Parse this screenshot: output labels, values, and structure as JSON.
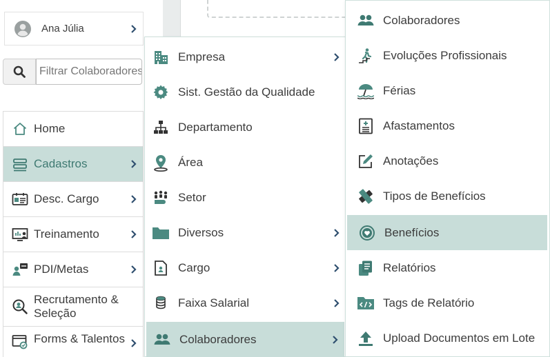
{
  "user": {
    "name": "Ana Júlia"
  },
  "search": {
    "placeholder": "Filtrar Colaboradores"
  },
  "sidebar": {
    "items": [
      {
        "label": "Home",
        "icon": "home-icon"
      },
      {
        "label": "Cadastros",
        "icon": "list-icon",
        "active": true
      },
      {
        "label": "Desc. Cargo",
        "icon": "job-description-icon"
      },
      {
        "label": "Treinamento",
        "icon": "training-icon"
      },
      {
        "label": "PDI/Metas",
        "icon": "goals-icon"
      },
      {
        "label": "Recrutamento & Seleção",
        "icon": "recruitment-icon"
      },
      {
        "label": "Forms & Talentos",
        "icon": "forms-icon"
      }
    ]
  },
  "menu_cadastros": {
    "items": [
      {
        "label": "Empresa",
        "icon": "building-icon"
      },
      {
        "label": "Sist. Gestão da Qualidade",
        "icon": "gear-icon"
      },
      {
        "label": "Departamento",
        "icon": "org-chart-icon"
      },
      {
        "label": "Área",
        "icon": "map-pin-icon"
      },
      {
        "label": "Setor",
        "icon": "people-group-icon"
      },
      {
        "label": "Diversos",
        "icon": "folder-icon"
      },
      {
        "label": "Cargo",
        "icon": "id-card-icon"
      },
      {
        "label": "Faixa Salarial",
        "icon": "coins-icon"
      },
      {
        "label": "Colaboradores",
        "icon": "users-icon",
        "active": true
      }
    ]
  },
  "menu_colaboradores": {
    "items": [
      {
        "label": "Colaboradores",
        "icon": "users-icon"
      },
      {
        "label": "Evoluções Profissionais",
        "icon": "stairs-icon"
      },
      {
        "label": "Férias",
        "icon": "beach-umbrella-icon"
      },
      {
        "label": "Afastamentos",
        "icon": "medical-document-icon"
      },
      {
        "label": "Anotações",
        "icon": "edit-icon"
      },
      {
        "label": "Tipos de Benefícios",
        "icon": "benefit-types-icon"
      },
      {
        "label": "Benefícios",
        "icon": "heart-badge-icon",
        "active": true
      },
      {
        "label": "Relatórios",
        "icon": "reports-icon"
      },
      {
        "label": "Tags de Relatório",
        "icon": "code-tag-icon"
      },
      {
        "label": "Upload Documentos em Lote",
        "icon": "upload-icon"
      }
    ]
  },
  "colors": {
    "accent": "#4b8a81",
    "active_bg": "#c8ddd9",
    "icon_dark": "#3f7a72",
    "chevron": "#2f4f6f"
  }
}
